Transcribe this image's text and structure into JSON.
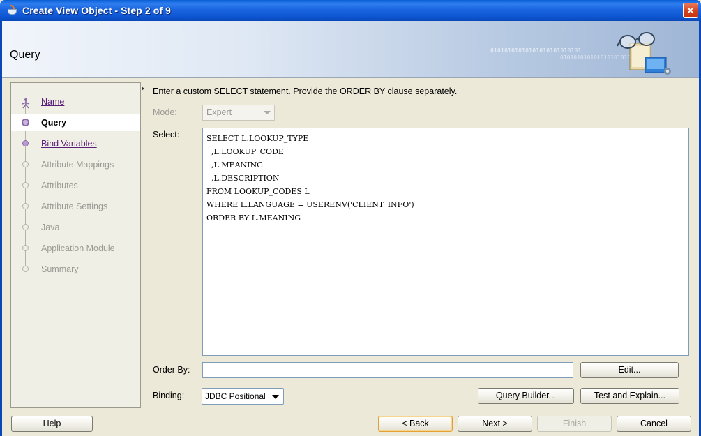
{
  "window": {
    "title": "Create View Object - Step 2 of 9",
    "close_glyph": "×"
  },
  "header": {
    "title": "Query",
    "binary_line1": "01010101010101010101010101",
    "binary_line2": "010101010101010101010"
  },
  "nav": {
    "items": [
      {
        "label": "Name",
        "state": "visited"
      },
      {
        "label": "Query",
        "state": "current"
      },
      {
        "label": "Bind Variables",
        "state": "visited"
      },
      {
        "label": "Attribute Mappings",
        "state": "disabled"
      },
      {
        "label": "Attributes",
        "state": "disabled"
      },
      {
        "label": "Attribute Settings",
        "state": "disabled"
      },
      {
        "label": "Java",
        "state": "disabled"
      },
      {
        "label": "Application Module",
        "state": "disabled"
      },
      {
        "label": "Summary",
        "state": "disabled"
      }
    ]
  },
  "main": {
    "instruction": "Enter a custom SELECT statement. Provide the ORDER BY clause separately.",
    "mode_label": "Mode:",
    "mode_value": "Expert",
    "select_label": "Select:",
    "sql": "SELECT L.LOOKUP_TYPE\n  ,L.LOOKUP_CODE\n  ,L.MEANING\n  ,L.DESCRIPTION\nFROM LOOKUP_CODES L\nWHERE L.LANGUAGE = USERENV('CLIENT_INFO')\nORDER BY L.MEANING",
    "orderby_label": "Order By:",
    "orderby_value": "",
    "binding_label": "Binding:",
    "binding_value": "JDBC Positional",
    "edit_button": "Edit...",
    "query_builder_button": "Query Builder...",
    "test_explain_button": "Test and Explain..."
  },
  "footer": {
    "help": "Help",
    "back": "< Back",
    "next": "Next >",
    "finish": "Finish",
    "cancel": "Cancel"
  },
  "colors": {
    "titlebar": "#0a5fd6",
    "link": "#5a1f7a",
    "disabled_text": "#9b9a93",
    "dialog_bg": "#ece9d8"
  }
}
